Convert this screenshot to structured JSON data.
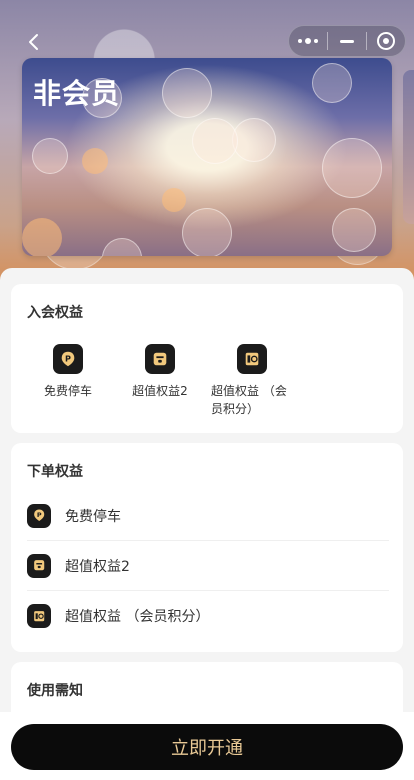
{
  "nav": {
    "back_icon": "chevron-left-icon",
    "capsule": {
      "more_icon": "more-dots-icon",
      "minimize_icon": "minus-icon",
      "close_icon": "target-icon"
    }
  },
  "card": {
    "title": "非会员"
  },
  "join_benefits": {
    "title": "入会权益",
    "items": [
      {
        "label": "免费停车",
        "icon": "parking-icon"
      },
      {
        "label": "超值权益2",
        "icon": "gift-box-icon"
      },
      {
        "label": "超值权益 （会员积分）",
        "icon": "points-icon"
      }
    ]
  },
  "order_benefits": {
    "title": "下单权益",
    "items": [
      {
        "label": "免费停车",
        "icon": "parking-icon"
      },
      {
        "label": "超值权益2",
        "icon": "gift-box-icon"
      },
      {
        "label": "超值权益 （会员积分）",
        "icon": "points-icon"
      }
    ]
  },
  "notice": {
    "title": "使用需知"
  },
  "cta": {
    "label": "立即开通"
  },
  "colors": {
    "accent": "#e9c996",
    "dark": "#0b0b0b",
    "icon_gold": "#f2c97d"
  }
}
